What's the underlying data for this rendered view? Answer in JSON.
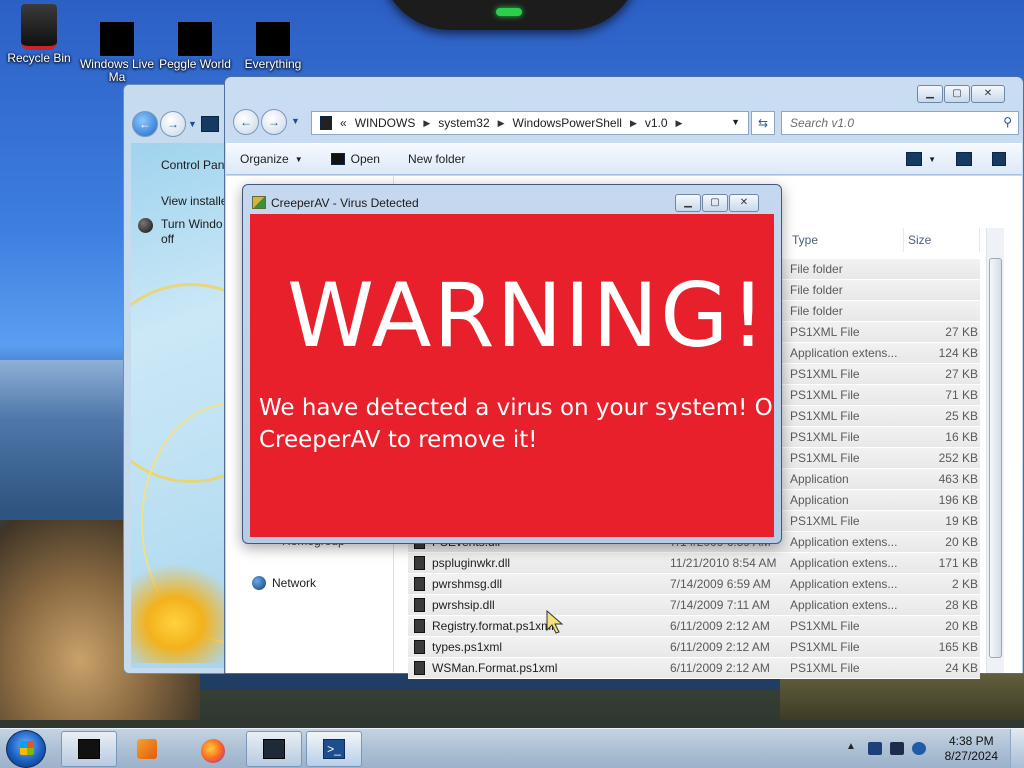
{
  "desktop": {
    "icons": [
      {
        "label": "Recycle Bin",
        "icon": "recycle-bin-icon"
      },
      {
        "label": "Windows Live Ma",
        "icon": "windows-live-icon"
      },
      {
        "label": "Peggle World",
        "icon": "peggle-icon"
      },
      {
        "label": "Everything",
        "icon": "everything-icon"
      }
    ]
  },
  "back_window": {
    "links": [
      "Control Pan",
      "View installe",
      "Turn Windo",
      "off"
    ]
  },
  "explorer": {
    "breadcrumb": [
      "«",
      "WINDOWS",
      "system32",
      "WindowsPowerShell",
      "v1.0"
    ],
    "search_placeholder": "Search v1.0",
    "toolbar": {
      "organize": "Organize",
      "open": "Open",
      "new_folder": "New folder"
    },
    "columns": {
      "type": "Type",
      "size": "Size"
    },
    "nav": {
      "network": "Network",
      "homegroup": "Homegroup"
    },
    "rows": [
      {
        "name": "",
        "date": "",
        "type": "File folder",
        "size": ""
      },
      {
        "name": "",
        "date": "",
        "type": "File folder",
        "size": ""
      },
      {
        "name": "",
        "date": "",
        "type": "File folder",
        "size": ""
      },
      {
        "name": "",
        "date": "",
        "type": "PS1XML File",
        "size": "27 KB"
      },
      {
        "name": "",
        "date": "",
        "type": "Application extens...",
        "size": "124 KB"
      },
      {
        "name": "",
        "date": "",
        "type": "PS1XML File",
        "size": "27 KB"
      },
      {
        "name": "",
        "date": "",
        "type": "PS1XML File",
        "size": "71 KB"
      },
      {
        "name": "",
        "date": "",
        "type": "PS1XML File",
        "size": "25 KB"
      },
      {
        "name": "",
        "date": "",
        "type": "PS1XML File",
        "size": "16 KB"
      },
      {
        "name": "",
        "date": "",
        "type": "PS1XML File",
        "size": "252 KB"
      },
      {
        "name": "",
        "date": "",
        "type": "Application",
        "size": "463 KB"
      },
      {
        "name": "",
        "date": "",
        "type": "Application",
        "size": "196 KB"
      },
      {
        "name": "",
        "date": "",
        "type": "PS1XML File",
        "size": "19 KB"
      },
      {
        "name": "PSEvents.dll",
        "date": "7/14/2009 6:59 AM",
        "type": "Application extens...",
        "size": "20 KB"
      },
      {
        "name": "pspluginwkr.dll",
        "date": "11/21/2010 8:54 AM",
        "type": "Application extens...",
        "size": "171 KB"
      },
      {
        "name": "pwrshmsg.dll",
        "date": "7/14/2009 6:59 AM",
        "type": "Application extens...",
        "size": "2 KB"
      },
      {
        "name": "pwrshsip.dll",
        "date": "7/14/2009 7:11 AM",
        "type": "Application extens...",
        "size": "28 KB"
      },
      {
        "name": "Registry.format.ps1xml",
        "date": "6/11/2009 2:12 AM",
        "type": "PS1XML File",
        "size": "20 KB"
      },
      {
        "name": "types.ps1xml",
        "date": "6/11/2009 2:12 AM",
        "type": "PS1XML File",
        "size": "165 KB"
      },
      {
        "name": "WSMan.Format.ps1xml",
        "date": "6/11/2009 2:12 AM",
        "type": "PS1XML File",
        "size": "24 KB"
      }
    ]
  },
  "dialog": {
    "title": "CreeperAV - Virus Detected",
    "heading": "WARNING!",
    "message": "We have detected a virus on your system! Open CreeperAV to remove it!",
    "bg_color": "#e8202b"
  },
  "taskbar": {
    "time": "4:38 PM",
    "date": "8/27/2024"
  }
}
